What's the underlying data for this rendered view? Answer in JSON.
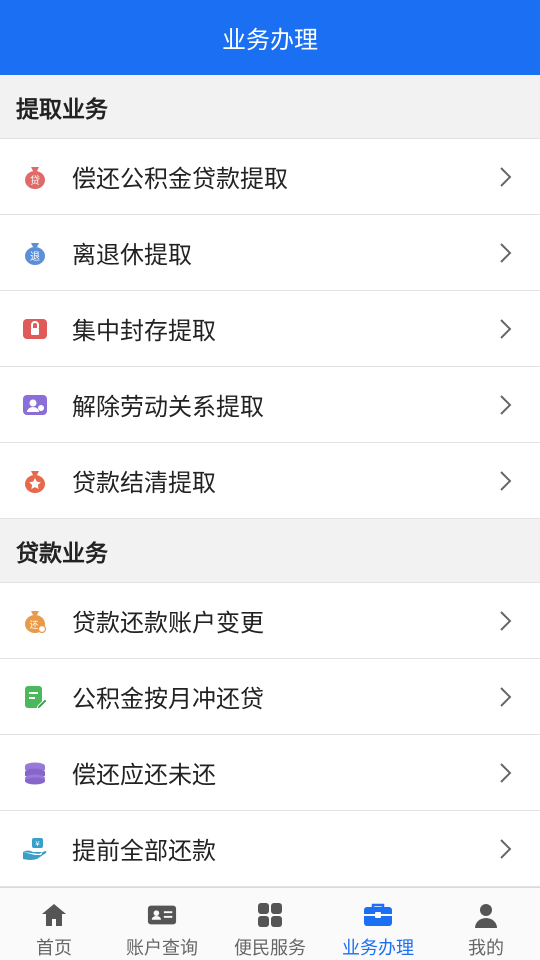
{
  "header": {
    "title": "业务办理"
  },
  "sections": [
    {
      "title": "提取业务",
      "items": [
        {
          "label": "偿还公积金贷款提取",
          "icon": "loan-repay-bag-icon"
        },
        {
          "label": "离退休提取",
          "icon": "retire-bag-icon"
        },
        {
          "label": "集中封存提取",
          "icon": "lock-icon"
        },
        {
          "label": "解除劳动关系提取",
          "icon": "person-card-icon"
        },
        {
          "label": "贷款结清提取",
          "icon": "star-bag-icon"
        }
      ]
    },
    {
      "title": "贷款业务",
      "items": [
        {
          "label": "贷款还款账户变更",
          "icon": "account-change-bag-icon"
        },
        {
          "label": "公积金按月冲还贷",
          "icon": "document-edit-icon"
        },
        {
          "label": "偿还应还未还",
          "icon": "coin-stack-icon"
        },
        {
          "label": "提前全部还款",
          "icon": "hand-money-icon"
        }
      ]
    }
  ],
  "tabbar": {
    "tabs": [
      {
        "label": "首页",
        "icon": "home-icon",
        "active": false
      },
      {
        "label": "账户查询",
        "icon": "id-card-icon",
        "active": false
      },
      {
        "label": "便民服务",
        "icon": "grid-icon",
        "active": false
      },
      {
        "label": "业务办理",
        "icon": "briefcase-icon",
        "active": true
      },
      {
        "label": "我的",
        "icon": "user-icon",
        "active": false
      }
    ]
  },
  "colors": {
    "accent": "#1a6ff2",
    "tab_inactive": "#666666"
  }
}
